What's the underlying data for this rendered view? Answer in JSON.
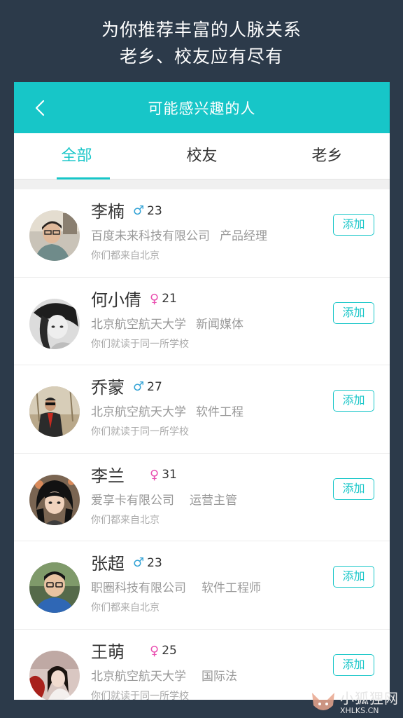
{
  "promo": {
    "line1": "为你推荐丰富的人脉关系",
    "line2": "老乡、校友应有尽有"
  },
  "header": {
    "title": "可能感兴趣的人"
  },
  "tabs": [
    {
      "label": "全部",
      "active": true
    },
    {
      "label": "校友",
      "active": false
    },
    {
      "label": "老乡",
      "active": false
    }
  ],
  "people": [
    {
      "name": "李楠",
      "gender": "male",
      "gender_symbol": "♂",
      "age": "23",
      "company": "百度未来科技有限公司",
      "job": "产品经理",
      "reason": "你们都来自北京",
      "add_label": "添加"
    },
    {
      "name": "何小倩",
      "gender": "female",
      "gender_symbol": "♀",
      "age": "21",
      "company": "北京航空航天大学",
      "job": "新闻媒体",
      "reason": "你们就读于同一所学校",
      "add_label": "添加"
    },
    {
      "name": "乔蒙",
      "gender": "male",
      "gender_symbol": "♂",
      "age": "27",
      "company": "北京航空航天大学",
      "job": "软件工程",
      "reason": "你们就读于同一所学校",
      "add_label": "添加"
    },
    {
      "name": "李兰",
      "gender": "female",
      "gender_symbol": "♀",
      "age": "31",
      "company": "爱享卡有限公司",
      "job": "运营主管",
      "reason": "你们都来自北京",
      "add_label": "添加"
    },
    {
      "name": "张超",
      "gender": "male",
      "gender_symbol": "♂",
      "age": "23",
      "company": "职圈科技有限公司",
      "job": "软件工程师",
      "reason": "你们都来自北京",
      "add_label": "添加"
    },
    {
      "name": "王萌",
      "gender": "female",
      "gender_symbol": "♀",
      "age": "25",
      "company": "北京航空航天大学",
      "job": "国际法",
      "reason": "你们就读于同一所学校",
      "add_label": "添加"
    }
  ],
  "watermark": {
    "cn": "小狐狸网",
    "en": "XHLKS.CN"
  },
  "colors": {
    "background": "#2c3a4a",
    "accent": "#17c6c8",
    "male": "#36a4d6",
    "female": "#e94fb0"
  }
}
